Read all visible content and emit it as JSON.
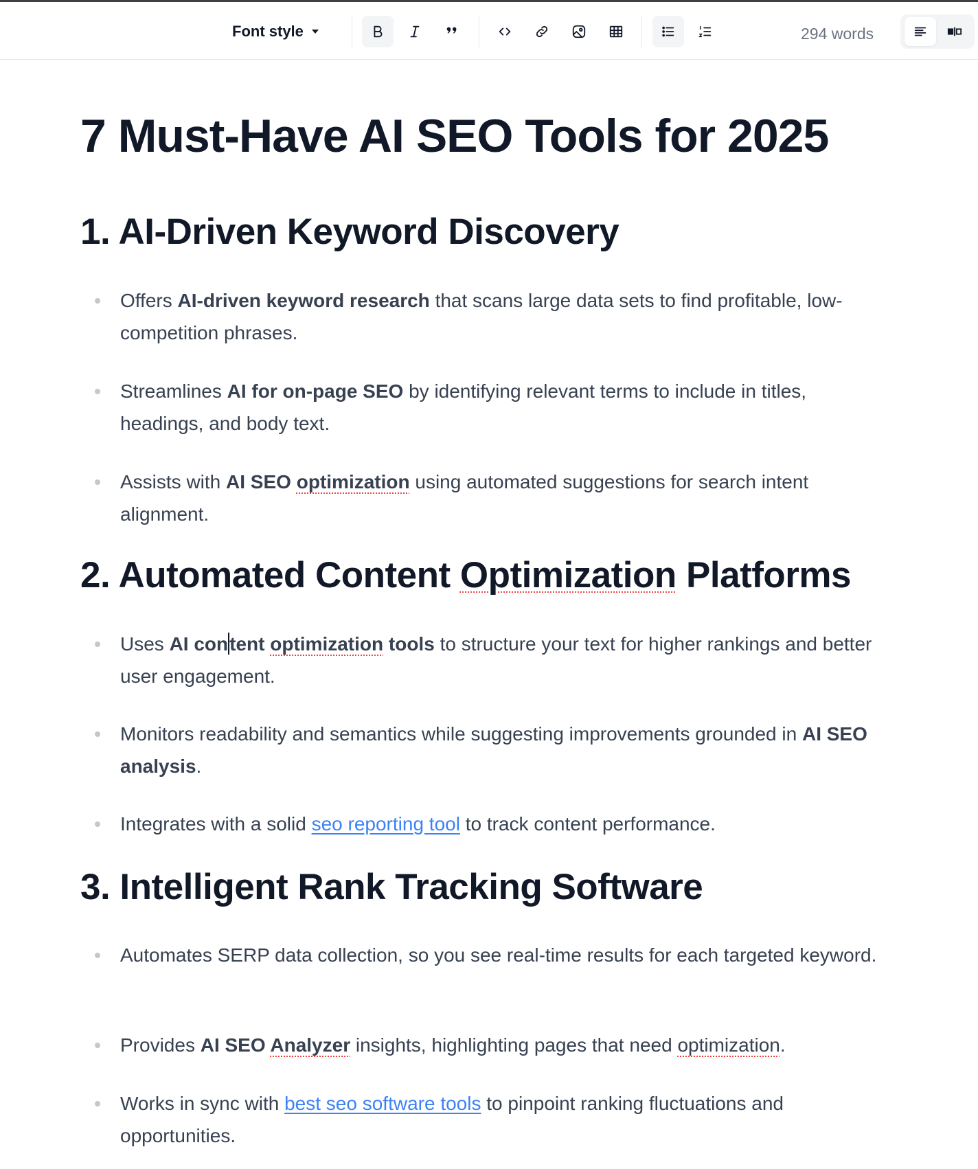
{
  "toolbar": {
    "font_style_label": "Font style",
    "word_count": "294 words",
    "buttons": [
      "bold",
      "italic",
      "quote",
      "code",
      "link",
      "image",
      "table",
      "bullet-list",
      "numbered-list"
    ]
  },
  "document": {
    "title": "7 Must-Have AI SEO Tools for 2025",
    "sections": [
      {
        "heading": "1. AI-Driven Keyword Discovery",
        "items": [
          {
            "pre": "Offers ",
            "bold": "AI-driven keyword research",
            "post": " that scans large data sets to find profitable, low-competition phrases."
          },
          {
            "pre": "Streamlines ",
            "bold": "AI for on-page SEO",
            "post": " by identifying relevant terms to include in titles, headings, and body text."
          },
          {
            "pre": "Assists with ",
            "bold_a": "AI SEO ",
            "bold_b": "optimization",
            "post": " using automated suggestions for search intent alignment."
          }
        ]
      },
      {
        "heading_a": "2. Automated Content ",
        "heading_b": "Optimization",
        "heading_c": " Platforms",
        "items": [
          {
            "pre": "Uses ",
            "bold_a": "AI con",
            "bold_b": "tent ",
            "bold_c": "optimization",
            "bold_d": " tools",
            "post": " to structure your text for higher rankings and better user engagement."
          },
          {
            "pre": "Monitors readability and semantics while suggesting improvements grounded in ",
            "bold": "AI SEO analysis",
            "post": "."
          },
          {
            "pre": "Integrates with a solid ",
            "link": "seo reporting tool",
            "post": " to track content performance."
          }
        ]
      },
      {
        "heading": "3. Intelligent Rank Tracking Software",
        "items": [
          {
            "text": "Automates SERP data collection, so you see real-time results for each targeted keyword."
          },
          {
            "pre": "Provides ",
            "bold_a": "AI SEO ",
            "bold_b": "Analyzer",
            "mid": " insights, highlighting pages that need ",
            "spell": "optimization",
            "post": "."
          },
          {
            "pre": "Works in sync with ",
            "link": "best seo software tools",
            "post": " to pinpoint ranking fluctuations and opportunities."
          }
        ]
      }
    ]
  }
}
